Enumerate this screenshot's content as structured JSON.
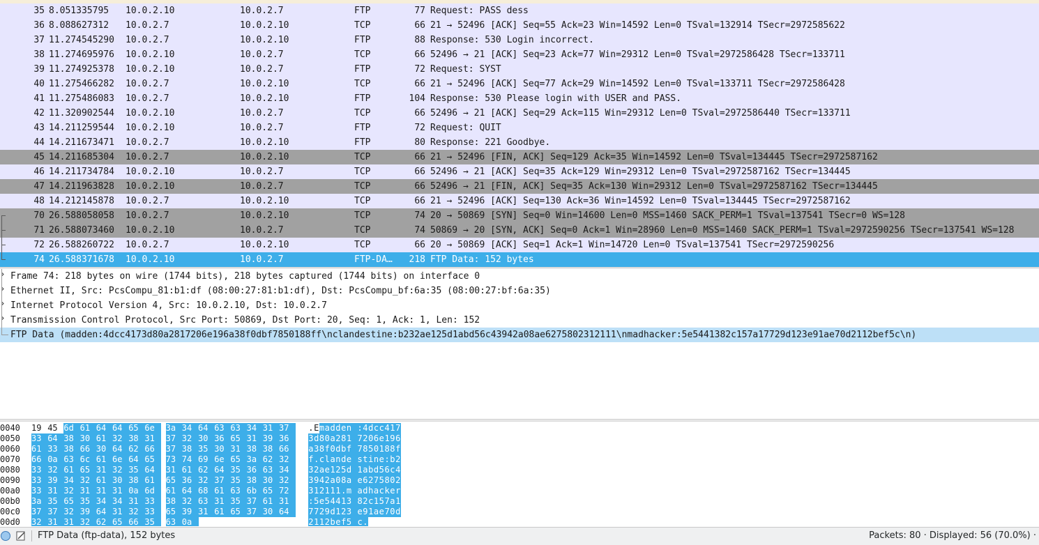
{
  "packets": [
    {
      "no": "35",
      "time": "8.051335795",
      "src": "10.0.2.10",
      "dst": "10.0.2.7",
      "proto": "FTP",
      "len": "77",
      "info": "Request: PASS dess",
      "color": "lav"
    },
    {
      "no": "36",
      "time": "8.088627312",
      "src": "10.0.2.7",
      "dst": "10.0.2.10",
      "proto": "TCP",
      "len": "66",
      "info": "21 → 52496 [ACK] Seq=55 Ack=23 Win=14592 Len=0 TSval=132914 TSecr=2972585622",
      "color": "lav"
    },
    {
      "no": "37",
      "time": "11.274545290",
      "src": "10.0.2.7",
      "dst": "10.0.2.10",
      "proto": "FTP",
      "len": "88",
      "info": "Response: 530 Login incorrect.",
      "color": "lav"
    },
    {
      "no": "38",
      "time": "11.274695976",
      "src": "10.0.2.10",
      "dst": "10.0.2.7",
      "proto": "TCP",
      "len": "66",
      "info": "52496 → 21 [ACK] Seq=23 Ack=77 Win=29312 Len=0 TSval=2972586428 TSecr=133711",
      "color": "lav"
    },
    {
      "no": "39",
      "time": "11.274925378",
      "src": "10.0.2.10",
      "dst": "10.0.2.7",
      "proto": "FTP",
      "len": "72",
      "info": "Request: SYST",
      "color": "lav"
    },
    {
      "no": "40",
      "time": "11.275466282",
      "src": "10.0.2.7",
      "dst": "10.0.2.10",
      "proto": "TCP",
      "len": "66",
      "info": "21 → 52496 [ACK] Seq=77 Ack=29 Win=14592 Len=0 TSval=133711 TSecr=2972586428",
      "color": "lav"
    },
    {
      "no": "41",
      "time": "11.275486083",
      "src": "10.0.2.7",
      "dst": "10.0.2.10",
      "proto": "FTP",
      "len": "104",
      "info": "Response: 530 Please login with USER and PASS.",
      "color": "lav"
    },
    {
      "no": "42",
      "time": "11.320902544",
      "src": "10.0.2.10",
      "dst": "10.0.2.7",
      "proto": "TCP",
      "len": "66",
      "info": "52496 → 21 [ACK] Seq=29 Ack=115 Win=29312 Len=0 TSval=2972586440 TSecr=133711",
      "color": "lav"
    },
    {
      "no": "43",
      "time": "14.211259544",
      "src": "10.0.2.10",
      "dst": "10.0.2.7",
      "proto": "FTP",
      "len": "72",
      "info": "Request: QUIT",
      "color": "lav"
    },
    {
      "no": "44",
      "time": "14.211673471",
      "src": "10.0.2.7",
      "dst": "10.0.2.10",
      "proto": "FTP",
      "len": "80",
      "info": "Response: 221 Goodbye.",
      "color": "lav"
    },
    {
      "no": "45",
      "time": "14.211685304",
      "src": "10.0.2.7",
      "dst": "10.0.2.10",
      "proto": "TCP",
      "len": "66",
      "info": "21 → 52496 [FIN, ACK] Seq=129 Ack=35 Win=14592 Len=0 TSval=134445 TSecr=2972587162",
      "color": "gray"
    },
    {
      "no": "46",
      "time": "14.211734784",
      "src": "10.0.2.10",
      "dst": "10.0.2.7",
      "proto": "TCP",
      "len": "66",
      "info": "52496 → 21 [ACK] Seq=35 Ack=129 Win=29312 Len=0 TSval=2972587162 TSecr=134445",
      "color": "lav"
    },
    {
      "no": "47",
      "time": "14.211963828",
      "src": "10.0.2.10",
      "dst": "10.0.2.7",
      "proto": "TCP",
      "len": "66",
      "info": "52496 → 21 [FIN, ACK] Seq=35 Ack=130 Win=29312 Len=0 TSval=2972587162 TSecr=134445",
      "color": "gray"
    },
    {
      "no": "48",
      "time": "14.212145878",
      "src": "10.0.2.7",
      "dst": "10.0.2.10",
      "proto": "TCP",
      "len": "66",
      "info": "21 → 52496 [ACK] Seq=130 Ack=36 Win=14592 Len=0 TSval=134445 TSecr=2972587162",
      "color": "lav"
    },
    {
      "no": "70",
      "time": "26.588058058",
      "src": "10.0.2.7",
      "dst": "10.0.2.10",
      "proto": "TCP",
      "len": "74",
      "info": "20 → 50869 [SYN] Seq=0 Win=14600 Len=0 MSS=1460 SACK_PERM=1 TSval=137541 TSecr=0 WS=128",
      "color": "gray"
    },
    {
      "no": "71",
      "time": "26.588073460",
      "src": "10.0.2.10",
      "dst": "10.0.2.7",
      "proto": "TCP",
      "len": "74",
      "info": "50869 → 20 [SYN, ACK] Seq=0 Ack=1 Win=28960 Len=0 MSS=1460 SACK_PERM=1 TSval=2972590256 TSecr=137541 WS=128",
      "color": "gray"
    },
    {
      "no": "72",
      "time": "26.588260722",
      "src": "10.0.2.7",
      "dst": "10.0.2.10",
      "proto": "TCP",
      "len": "66",
      "info": "20 → 50869 [ACK] Seq=1 Ack=1 Win=14720 Len=0 TSval=137541 TSecr=2972590256",
      "color": "lav"
    },
    {
      "no": "74",
      "time": "26.588371678",
      "src": "10.0.2.10",
      "dst": "10.0.2.7",
      "proto": "FTP-DA…",
      "len": "218",
      "info": "FTP Data: 152 bytes",
      "color": "sel"
    }
  ],
  "details": [
    {
      "text": "Frame 74: 218 bytes on wire (1744 bits), 218 bytes captured (1744 bits) on interface 0",
      "expandable": true
    },
    {
      "text": "Ethernet II, Src: PcsCompu_81:b1:df (08:00:27:81:b1:df), Dst: PcsCompu_bf:6a:35 (08:00:27:bf:6a:35)",
      "expandable": true
    },
    {
      "text": "Internet Protocol Version 4, Src: 10.0.2.10, Dst: 10.0.2.7",
      "expandable": true
    },
    {
      "text": "Transmission Control Protocol, Src Port: 50869, Dst Port: 20, Seq: 1, Ack: 1, Len: 152",
      "expandable": true
    },
    {
      "text": "FTP Data (madden:4dcc4173d80a2817206e196a38f0dbf7850188ff\\nclandestine:b232ae125d1abd56c43942a08ae6275802312111\\nmadhacker:5e5441382c157a17729d123e91ae70d2112bef5c\\n)",
      "expandable": false,
      "selected": true
    }
  ],
  "bytes": [
    {
      "offset": "0040",
      "hex": [
        "19",
        "45",
        "6d",
        "61",
        "64",
        "64",
        "65",
        "6e",
        "3a",
        "34",
        "64",
        "63",
        "63",
        "34",
        "31",
        "37"
      ],
      "ascii": ".Emadden :4dcc417",
      "hlstart": 2
    },
    {
      "offset": "0050",
      "hex": [
        "33",
        "64",
        "38",
        "30",
        "61",
        "32",
        "38",
        "31",
        "37",
        "32",
        "30",
        "36",
        "65",
        "31",
        "39",
        "36"
      ],
      "ascii": "3d80a281 7206e196",
      "hlstart": 0
    },
    {
      "offset": "0060",
      "hex": [
        "61",
        "33",
        "38",
        "66",
        "30",
        "64",
        "62",
        "66",
        "37",
        "38",
        "35",
        "30",
        "31",
        "38",
        "38",
        "66"
      ],
      "ascii": "a38f0dbf 7850188f",
      "hlstart": 0
    },
    {
      "offset": "0070",
      "hex": [
        "66",
        "0a",
        "63",
        "6c",
        "61",
        "6e",
        "64",
        "65",
        "73",
        "74",
        "69",
        "6e",
        "65",
        "3a",
        "62",
        "32"
      ],
      "ascii": "f.clande stine:b2",
      "hlstart": 0
    },
    {
      "offset": "0080",
      "hex": [
        "33",
        "32",
        "61",
        "65",
        "31",
        "32",
        "35",
        "64",
        "31",
        "61",
        "62",
        "64",
        "35",
        "36",
        "63",
        "34"
      ],
      "ascii": "32ae125d 1abd56c4",
      "hlstart": 0
    },
    {
      "offset": "0090",
      "hex": [
        "33",
        "39",
        "34",
        "32",
        "61",
        "30",
        "38",
        "61",
        "65",
        "36",
        "32",
        "37",
        "35",
        "38",
        "30",
        "32"
      ],
      "ascii": "3942a08a e6275802",
      "hlstart": 0
    },
    {
      "offset": "00a0",
      "hex": [
        "33",
        "31",
        "32",
        "31",
        "31",
        "31",
        "0a",
        "6d",
        "61",
        "64",
        "68",
        "61",
        "63",
        "6b",
        "65",
        "72"
      ],
      "ascii": "312111.m adhacker",
      "hlstart": 0
    },
    {
      "offset": "00b0",
      "hex": [
        "3a",
        "35",
        "65",
        "35",
        "34",
        "34",
        "31",
        "33",
        "38",
        "32",
        "63",
        "31",
        "35",
        "37",
        "61",
        "31"
      ],
      "ascii": ":5e54413 82c157a1",
      "hlstart": 0
    },
    {
      "offset": "00c0",
      "hex": [
        "37",
        "37",
        "32",
        "39",
        "64",
        "31",
        "32",
        "33",
        "65",
        "39",
        "31",
        "61",
        "65",
        "37",
        "30",
        "64"
      ],
      "ascii": "7729d123 e91ae70d",
      "hlstart": 0
    },
    {
      "offset": "00d0",
      "hex": [
        "32",
        "31",
        "31",
        "32",
        "62",
        "65",
        "66",
        "35",
        "63",
        "0a"
      ],
      "ascii": "2112bef5 c.",
      "hlstart": 0
    }
  ],
  "status": {
    "message": "FTP Data (ftp-data), 152 bytes",
    "packets": "Packets: 80 · Displayed: 56 (70.0%) ·"
  },
  "colors": {
    "selection": "#3daee9",
    "detail_selection": "#bde0f7",
    "row_lavender": "#e7e6fe",
    "row_gray": "#a1a1a1"
  }
}
